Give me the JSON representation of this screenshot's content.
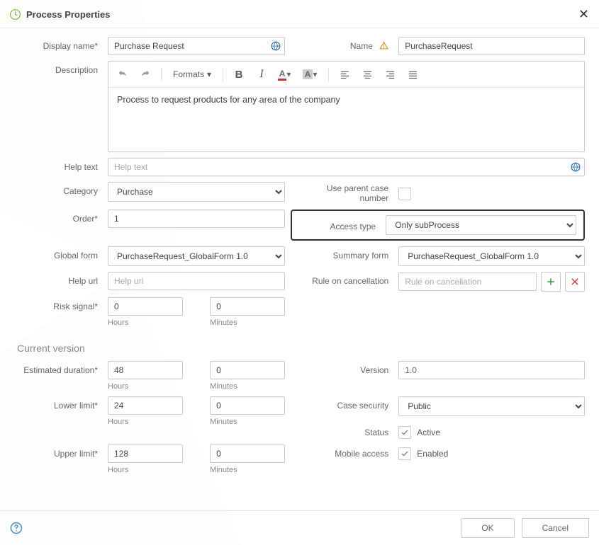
{
  "header": {
    "title": "Process Properties"
  },
  "labels": {
    "display_name": "Display name*",
    "name": "Name",
    "description": "Description",
    "help_text": "Help text",
    "category": "Category",
    "use_parent": "Use parent case number",
    "order": "Order*",
    "access_type": "Access type",
    "global_form": "Global form",
    "summary_form": "Summary form",
    "help_url": "Help url",
    "rule_cancel": "Rule on cancellation",
    "risk_signal": "Risk signal*",
    "hours": "Hours",
    "minutes": "Minutes",
    "current_version": "Current version",
    "est_duration": "Estimated duration*",
    "lower_limit": "Lower limit*",
    "upper_limit": "Upper limit*",
    "version": "Version",
    "case_security": "Case security",
    "status": "Status",
    "mobile_access": "Mobile access",
    "active": "Active",
    "enabled": "Enabled"
  },
  "values": {
    "display_name": "Purchase Request",
    "name": "PurchaseRequest",
    "description_body": "Process to request products for any area of the company",
    "help_text_placeholder": "Help text",
    "category": "Purchase",
    "order": "1",
    "access_type": "Only subProcess",
    "global_form": "PurchaseRequest_GlobalForm 1.0",
    "summary_form": "PurchaseRequest_GlobalForm 1.0",
    "help_url_placeholder": "Help url",
    "rule_cancel_placeholder": "Rule on cancellation",
    "risk_hours": "0",
    "risk_minutes": "0",
    "est_hours": "48",
    "est_minutes": "0",
    "lower_hours": "24",
    "lower_minutes": "0",
    "upper_hours": "128",
    "upper_minutes": "0",
    "version": "1.0",
    "case_security": "Public"
  },
  "toolbar": {
    "formats": "Formats"
  },
  "buttons": {
    "ok": "OK",
    "cancel": "Cancel"
  }
}
